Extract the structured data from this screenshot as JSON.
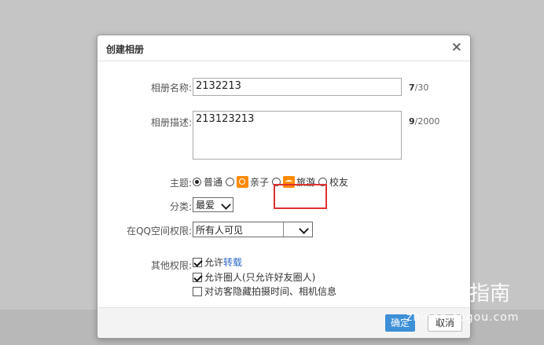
{
  "dialog": {
    "title": "创建相册",
    "close_symbol": "×",
    "name_label": "相册名称:",
    "name_value": "2132213",
    "name_count": "7",
    "name_max": "/30",
    "desc_label": "相册描述:",
    "desc_value": "213123213",
    "desc_count": "9",
    "desc_max": "/2000",
    "theme_label": "主题:",
    "themes": [
      {
        "label": "普通",
        "checked": true
      },
      {
        "label": "亲子",
        "checked": false,
        "icon": "kid-icon"
      },
      {
        "label": "旅游",
        "checked": false,
        "icon": "travel-icon"
      },
      {
        "label": "校友",
        "checked": false
      }
    ],
    "category_label": "分类:",
    "category_value": "最爱",
    "permission_label": "在QQ空间权限:",
    "permission_value": "所有人可见",
    "other_label": "其他权限:",
    "options": [
      {
        "prefix": "允许",
        "link": "转载",
        "checked": true
      },
      {
        "prefix": "允许圈人(只允许好友圈人)",
        "link": "",
        "checked": true
      },
      {
        "prefix": "对访客隐藏拍摄时间、相机信息",
        "link": "",
        "checked": false
      }
    ],
    "ok_label": "确定",
    "cancel_label": "取消"
  },
  "watermark": {
    "brand": "搜狗指南",
    "logo_letter": "S",
    "url": "zhinan.sogou.com"
  },
  "colors": {
    "accent": "#3d8fd8",
    "highlight": "#e03030",
    "link": "#2a66c7",
    "theme_icon": "#ff8a00"
  }
}
